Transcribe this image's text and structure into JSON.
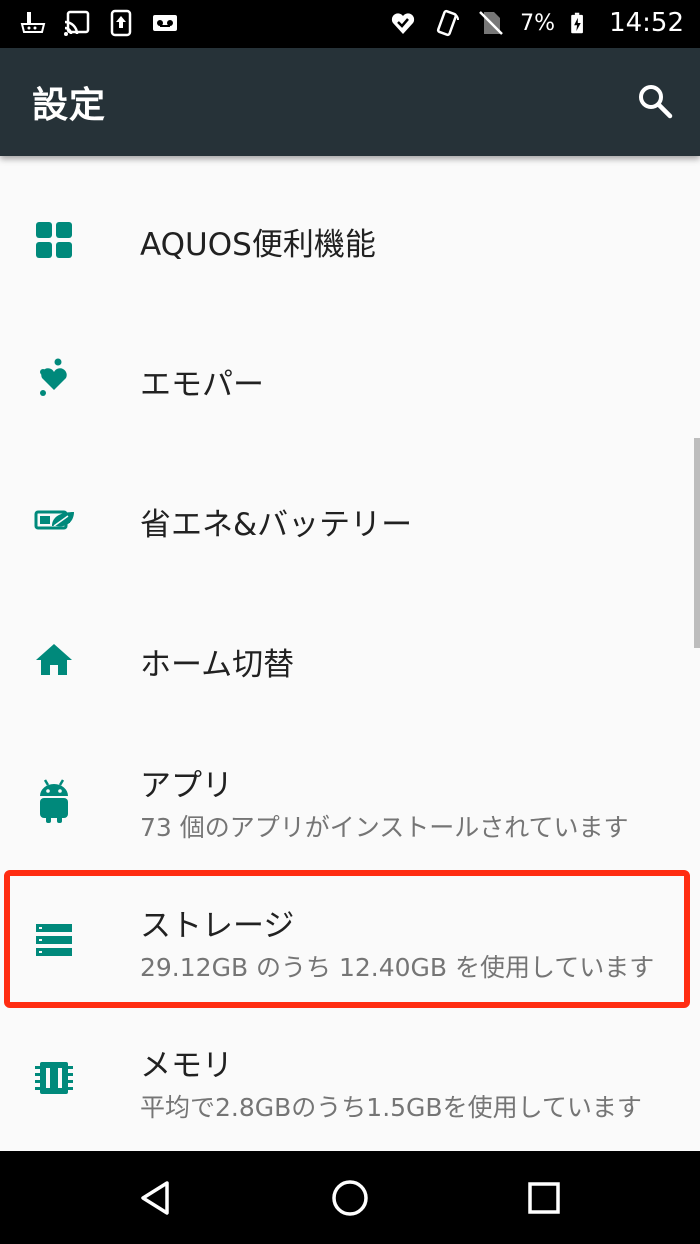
{
  "status_bar": {
    "battery_percent": "7%",
    "time": "14:52",
    "left_icons": [
      "usb-debug-icon",
      "cast-icon",
      "upload-icon",
      "voicemail-icon"
    ],
    "right_icons": [
      "emopa-status-icon",
      "vibrate-icon",
      "no-sim-icon",
      "battery-charging-icon"
    ]
  },
  "app_bar": {
    "title": "設定",
    "search_icon": "search-icon"
  },
  "settings": {
    "items": [
      {
        "icon": "grid-icon",
        "title": "AQUOS便利機能"
      },
      {
        "icon": "emopa-icon",
        "title": "エモパー"
      },
      {
        "icon": "battery-leaf-icon",
        "title": "省エネ&バッテリー"
      },
      {
        "icon": "home-icon",
        "title": "ホーム切替"
      },
      {
        "icon": "android-icon",
        "title": "アプリ",
        "summary": "73 個のアプリがインストールされています"
      },
      {
        "icon": "storage-icon",
        "title": "ストレージ",
        "summary": "29.12GB のうち 12.40GB を使用しています",
        "highlighted": true
      },
      {
        "icon": "memory-icon",
        "title": "メモリ",
        "summary": "平均で2.8GBのうち1.5GBを使用しています"
      }
    ]
  },
  "nav_bar": {
    "buttons": [
      "back-icon",
      "home-circle-icon",
      "recents-icon"
    ]
  },
  "colors": {
    "accent": "#00897b",
    "app_bar": "#263238",
    "highlight": "#ff2d12"
  }
}
